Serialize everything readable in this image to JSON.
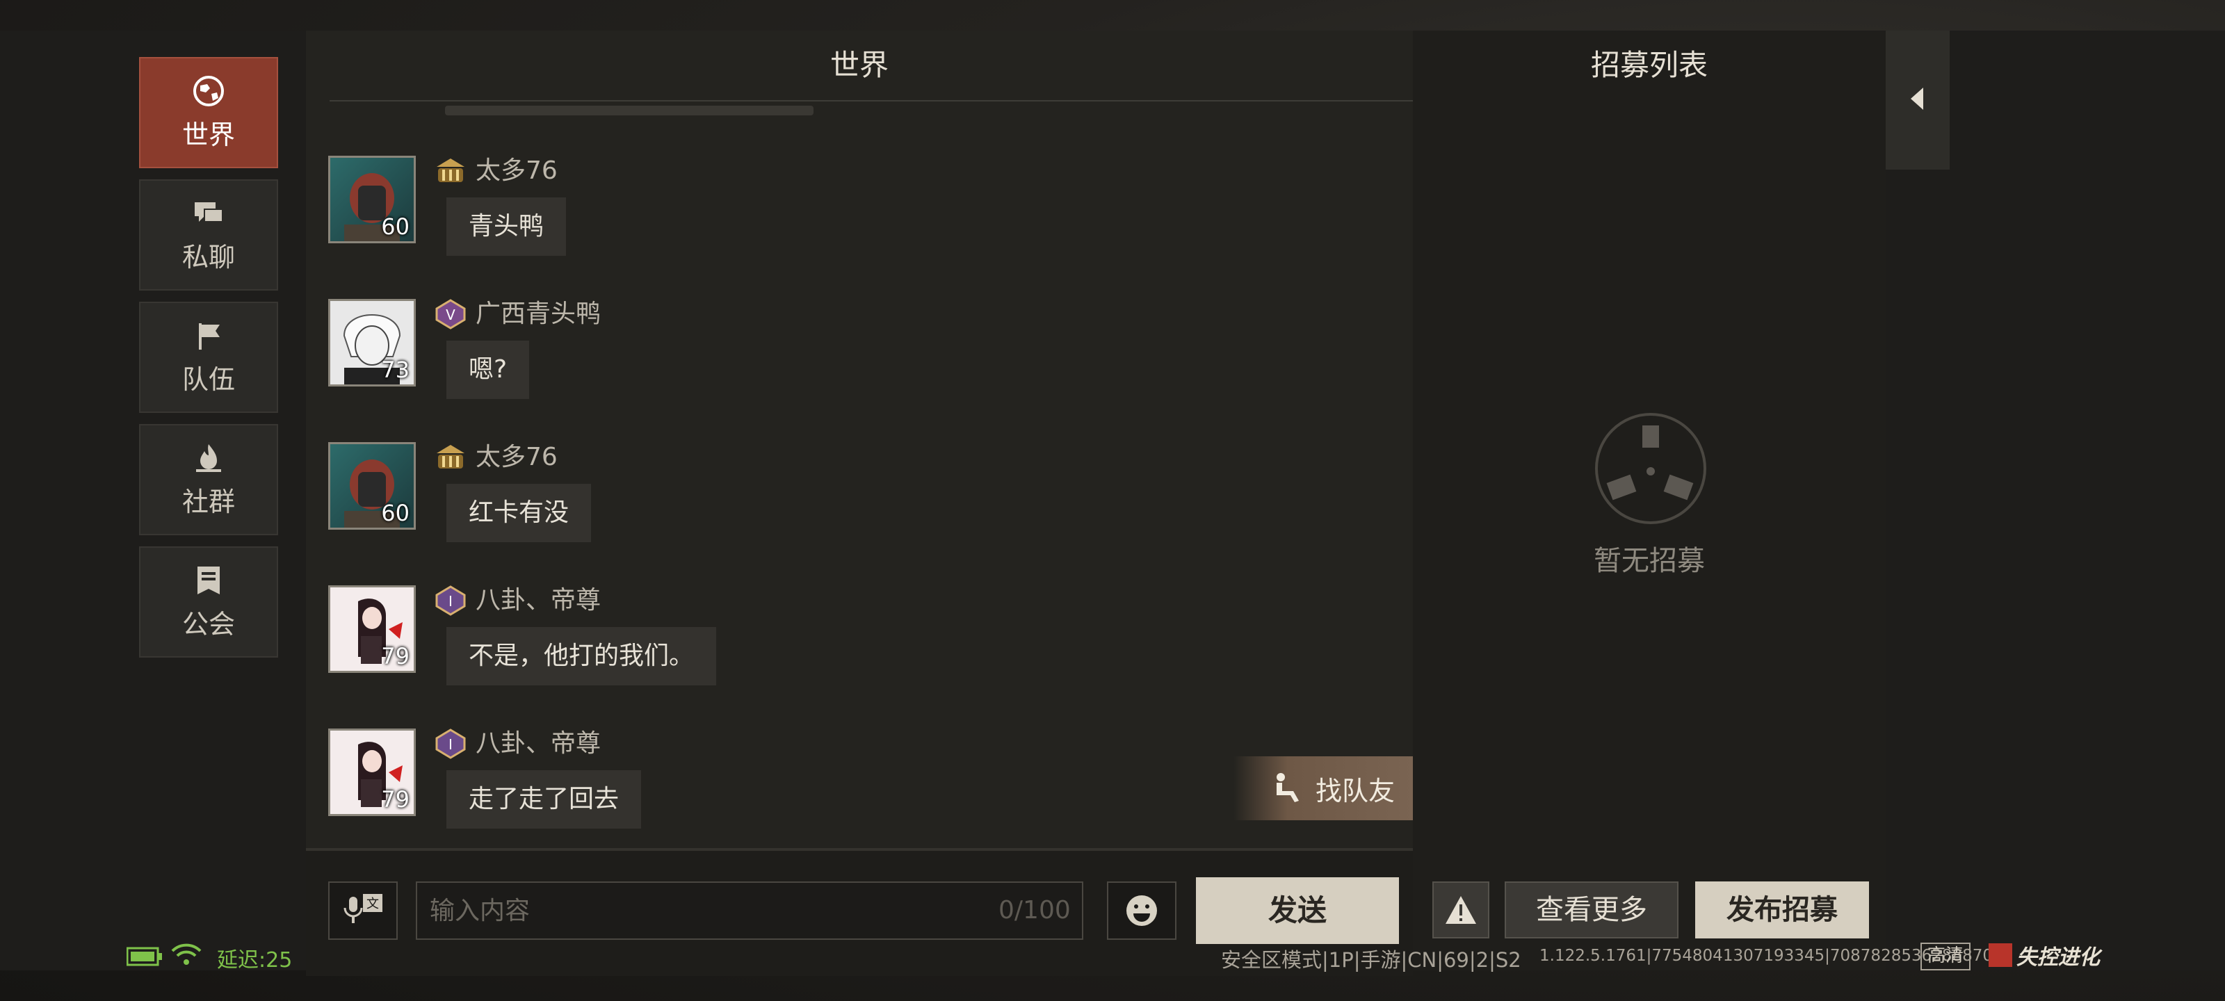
{
  "nav": {
    "items": [
      {
        "label": "世界",
        "icon": "globe-icon",
        "active": true
      },
      {
        "label": "私聊",
        "icon": "chat-bubbles-icon",
        "active": false
      },
      {
        "label": "队伍",
        "icon": "flag-icon",
        "active": false
      },
      {
        "label": "社群",
        "icon": "campfire-icon",
        "active": false
      },
      {
        "label": "公会",
        "icon": "guild-banner-icon",
        "active": false
      }
    ]
  },
  "chat": {
    "title": "世界",
    "messages": [
      {
        "name": "太多76",
        "level": "60",
        "badge": "rank-pillar-badge",
        "text": "青头鸭"
      },
      {
        "name": "广西青头鸭",
        "level": "73",
        "badge": "rank-v-badge",
        "text": "嗯?"
      },
      {
        "name": "太多76",
        "level": "60",
        "badge": "rank-pillar-badge",
        "text": "红卡有没"
      },
      {
        "name": "八卦、帝尊",
        "level": "79",
        "badge": "rank-i-badge",
        "text": "不是，他打的我们。"
      },
      {
        "name": "八卦、帝尊",
        "level": "79",
        "badge": "rank-i-badge",
        "text": "走了走了回去"
      }
    ],
    "find_teammate": "找队友"
  },
  "input": {
    "placeholder": "输入内容",
    "counter": "0/100",
    "send": "发送"
  },
  "recruit": {
    "title": "招募列表",
    "empty": "暂无招募",
    "more": "查看更多",
    "post": "发布招募"
  },
  "status": {
    "latency": "延迟:25",
    "server": "安全区模式|1P|手游|CN|69|2|S2",
    "build": "1.122.5.1761|77548041307193345|70878285362888705",
    "quality": "高清",
    "logo": "失控进化"
  },
  "colors": {
    "active_tab": "#8a3b2c",
    "latency_green": "#7fc24a",
    "primary_button": "#d6cfc0"
  }
}
